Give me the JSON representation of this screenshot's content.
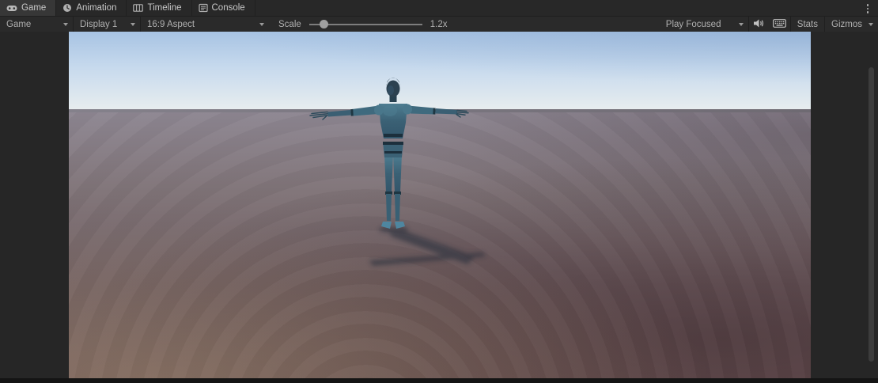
{
  "tabs": [
    {
      "label": "Game",
      "icon": "gamepad-icon",
      "active": true
    },
    {
      "label": "Animation",
      "icon": "clock-icon",
      "active": false
    },
    {
      "label": "Timeline",
      "icon": "timeline-icon",
      "active": false
    },
    {
      "label": "Console",
      "icon": "console-icon",
      "active": false
    }
  ],
  "tab_bar": {
    "overflow_menu": "kebab-menu"
  },
  "toolbar": {
    "game_dropdown": "Game",
    "display_dropdown": "Display 1",
    "aspect_dropdown": "16:9 Aspect",
    "scale_label": "Scale",
    "scale_value": "1.2x",
    "scale_percent": 13,
    "play_focused_dropdown": "Play Focused",
    "mute_audio_icon": "speaker-icon",
    "keyboard_icon": "keyboard-icon",
    "stats_button": "Stats",
    "gizmos_button": "Gizmos"
  },
  "viewport": {
    "description": "3D game render: blue humanoid mannequin standing in T-pose on reddish-brown ground under a pale blue sky, casting a shadow to the lower right"
  },
  "colors": {
    "sky-top": "#a7c3e3",
    "sky-horizon": "#e7edef",
    "ground-near-horizon": "#8d8691",
    "ground-bottom": "#6b5455",
    "character-body": "#3b6175",
    "character-highlight": "#4e7e92",
    "character-dark": "#1e3642",
    "panel-bg": "#262626",
    "bar-bg": "#282828",
    "tab-active-bg": "#373737",
    "text": "#c2c2c2"
  }
}
